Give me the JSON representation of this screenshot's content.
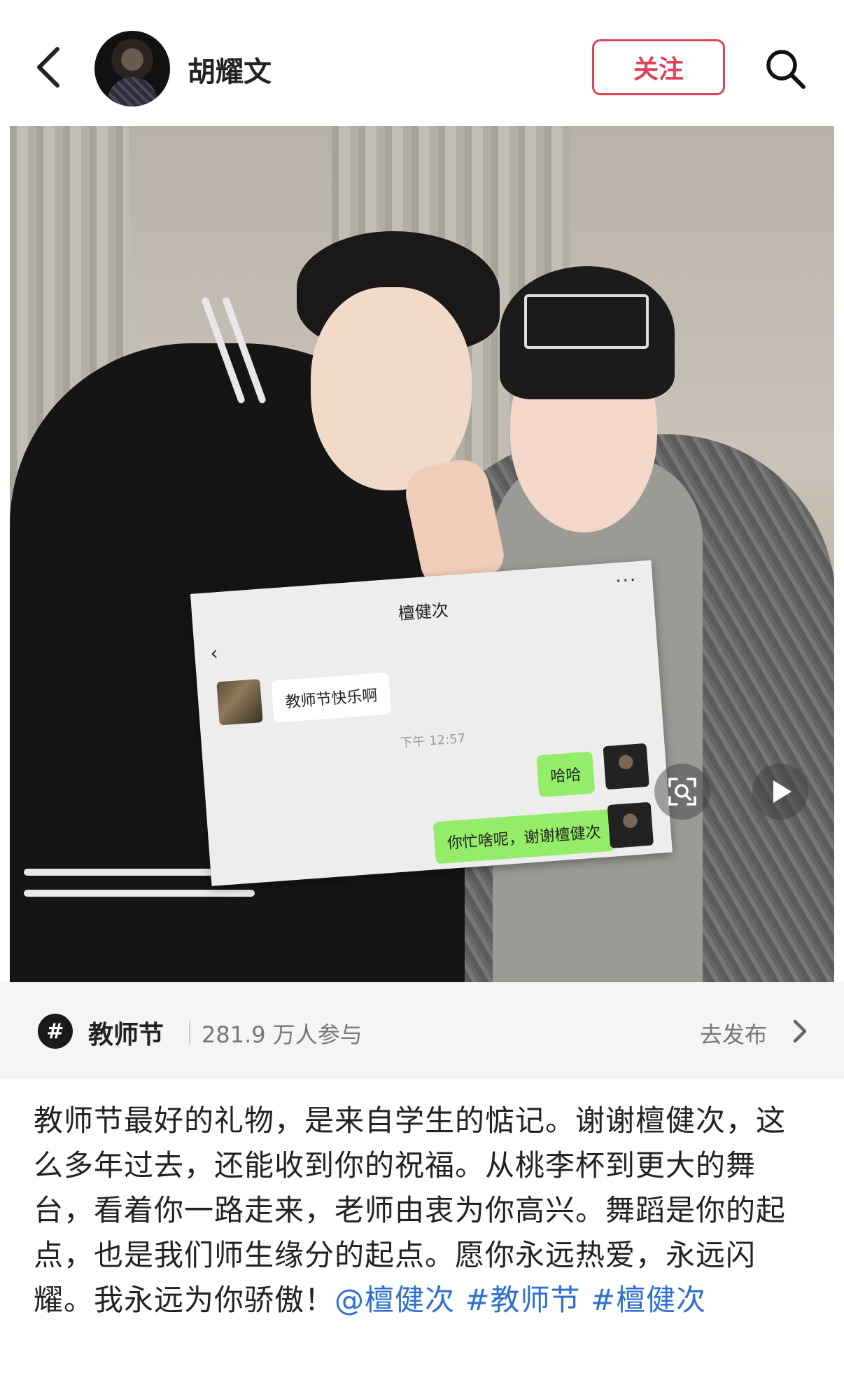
{
  "header": {
    "username": "胡耀文",
    "follow_label": "关注"
  },
  "chat": {
    "title": "檀健次",
    "dots": "···",
    "back": "‹",
    "incoming": "教师节快乐啊",
    "time": "下午 12:57",
    "outgoing_1": "哈哈",
    "outgoing_2": "你忙啥呢，谢谢檀健次"
  },
  "topic": {
    "icon": "#",
    "name": "教师节",
    "participants": "281.9 万人参与",
    "action": "去发布"
  },
  "post": {
    "text": "教师节最好的礼物，是来自学生的惦记。谢谢檀健次，这么多年过去，还能收到你的祝福。从桃李杯到更大的舞台，看着你一路走来，老师由衷为你高兴。舞蹈是你的起点，也是我们师生缘分的起点。愿你永远热爱，永远闪耀。我永远为你骄傲！",
    "mention": "@檀健次",
    "tag1": "#教师节",
    "tag2": "#檀健次"
  },
  "icons": {
    "back": "back-arrow-icon",
    "search": "search-icon",
    "scan": "scan-icon",
    "play": "play-icon",
    "topic": "hashtag-icon",
    "chevron": "chevron-right-icon"
  },
  "colors": {
    "accent": "#e0425a",
    "link": "#2f6fd0",
    "chat_green": "#95ec69"
  }
}
